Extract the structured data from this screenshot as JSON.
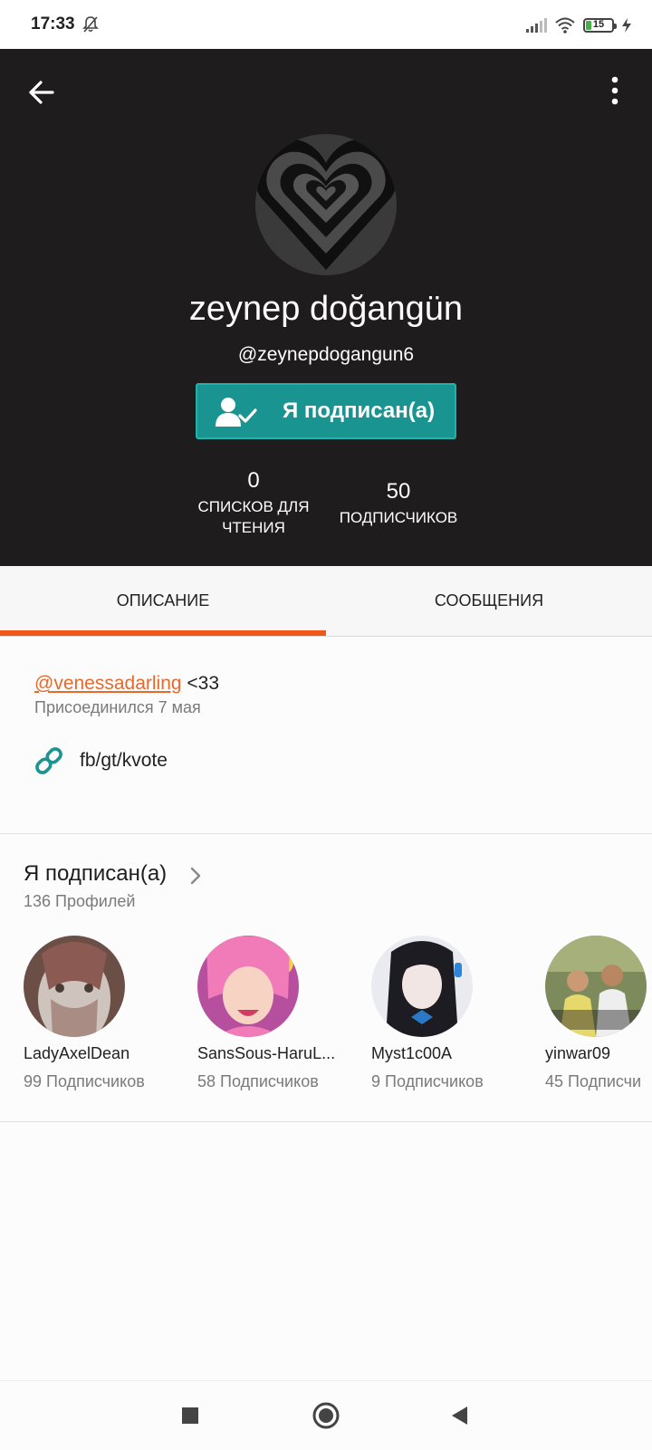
{
  "status_bar": {
    "time": "17:33",
    "battery": "15",
    "icons": [
      "bell-off-icon",
      "signal-icon",
      "wifi-icon",
      "battery-icon",
      "charging-icon"
    ]
  },
  "header": {
    "back_icon": "arrow-left-icon",
    "more_icon": "more-vertical-icon",
    "name": "zeynep doğangün",
    "handle": "@zeynepdogangun6",
    "follow_button": {
      "label": "Я подписан(а)",
      "icon": "user-check-icon"
    },
    "stats": {
      "reading_lists": {
        "value": "0",
        "label_line1": "СПИСКОВ ДЛЯ",
        "label_line2": "ЧТЕНИЯ"
      },
      "followers": {
        "value": "50",
        "label": "ПОДПИСЧИКОВ"
      }
    },
    "background_color": "#1e1c1d",
    "accent_color": "#1a9490"
  },
  "tabs": [
    {
      "label": "ОПИСАНИЕ",
      "active": true
    },
    {
      "label": "СООБЩЕНИЯ",
      "active": false
    }
  ],
  "tab_indicator_color": "#f1591a",
  "about": {
    "mention": "@venessadarling",
    "text": " <33",
    "joined": "Присоединился 7 мая",
    "website": "fb/gt/kvote",
    "link_icon": "link-icon"
  },
  "following": {
    "title": "Я подписан(а)",
    "count": "136 Профилей",
    "users": [
      {
        "name": "LadyAxelDean",
        "followers": "99 Подписчиков"
      },
      {
        "name": "SansSous-HaruL...",
        "followers": "58 Подписчиков"
      },
      {
        "name": "Myst1c00A",
        "followers": "9 Подписчиков"
      },
      {
        "name": "yinwar09",
        "followers": "45 Подписчи"
      }
    ]
  },
  "nav_bar": {
    "icons": [
      "recents-square-icon",
      "home-circle-icon",
      "back-triangle-icon"
    ]
  }
}
